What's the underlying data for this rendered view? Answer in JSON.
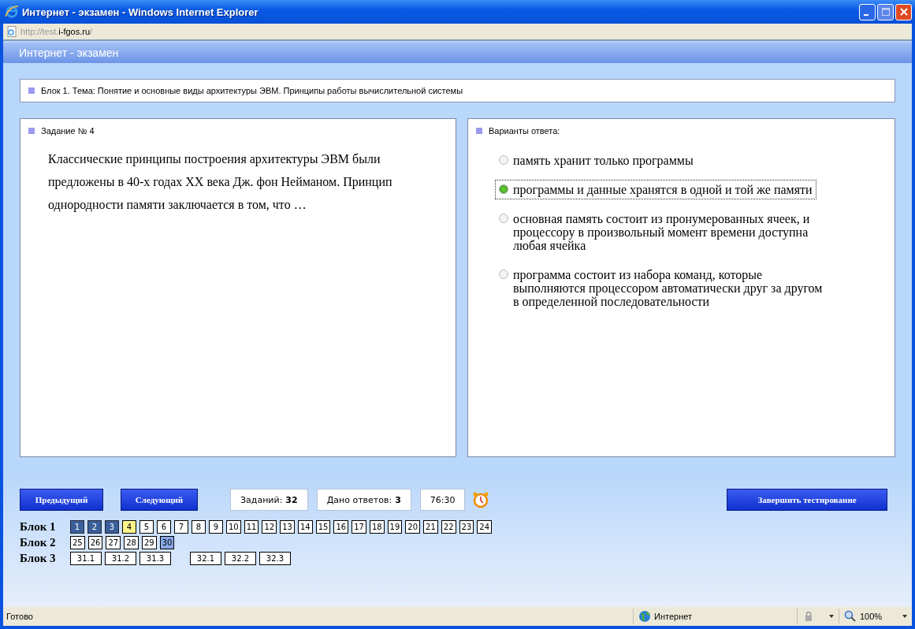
{
  "window": {
    "title": "Интернет - экзамен - Windows Internet Explorer"
  },
  "address": [
    {
      "text": "http://test.",
      "kind": "muted"
    },
    {
      "text": "i-fgos.ru",
      "kind": "host"
    },
    {
      "text": "/",
      "kind": "muted"
    }
  ],
  "page_header": "Интернет - экзамен",
  "topic": "Блок 1. Тема: Понятие и основные виды архитектуры ЭВМ. Принципы работы вычислительной системы",
  "task": {
    "title": "Задание № 4",
    "text": "Классические принципы построения архитектуры ЭВМ были предложены в 40-х годах XX века Дж. фон Нейманом. Принцип однородности памяти заключается в том, что …"
  },
  "answers": {
    "title": "Варианты ответа:",
    "options": [
      {
        "text": "память хранит только программы",
        "selected": false
      },
      {
        "text": "программы и данные хранятся в одной и той же памяти",
        "selected": true
      },
      {
        "text": "основная память состоит из пронумерованных ячеек, и процессору в произвольный момент времени доступна любая ячейка",
        "selected": false
      },
      {
        "text": "программа состоит из набора команд, которые выполняются процессором автоматически друг за другом в определенной последовательности",
        "selected": false
      }
    ]
  },
  "buttons": {
    "prev": "Предыдущий",
    "next": "Следующий",
    "finish": "Завершить тестирование"
  },
  "stats": [
    {
      "label": "Заданий:",
      "value": "32"
    },
    {
      "label": "Дано ответов:",
      "value": "3"
    },
    {
      "value": "76:30"
    }
  ],
  "blocks": [
    {
      "label": "Блок 1",
      "groups": [
        [
          {
            "n": "1",
            "kind": "answered"
          },
          {
            "n": "2",
            "kind": "answered"
          },
          {
            "n": "3",
            "kind": "answered"
          },
          {
            "n": "4",
            "kind": "current"
          },
          {
            "n": "5",
            "kind": "plain"
          },
          {
            "n": "6",
            "kind": "plain"
          },
          {
            "n": "7",
            "kind": "plain"
          },
          {
            "n": "8",
            "kind": "plain"
          },
          {
            "n": "9",
            "kind": "plain"
          },
          {
            "n": "10",
            "kind": "plain"
          },
          {
            "n": "11",
            "kind": "plain"
          },
          {
            "n": "12",
            "kind": "plain"
          },
          {
            "n": "13",
            "kind": "plain"
          },
          {
            "n": "14",
            "kind": "plain"
          },
          {
            "n": "15",
            "kind": "plain"
          },
          {
            "n": "16",
            "kind": "plain"
          },
          {
            "n": "17",
            "kind": "plain"
          },
          {
            "n": "18",
            "kind": "plain"
          },
          {
            "n": "19",
            "kind": "plain"
          },
          {
            "n": "20",
            "kind": "plain"
          },
          {
            "n": "21",
            "kind": "plain"
          },
          {
            "n": "22",
            "kind": "plain"
          },
          {
            "n": "23",
            "kind": "plain"
          },
          {
            "n": "24",
            "kind": "plain"
          }
        ]
      ]
    },
    {
      "label": "Блок 2",
      "groups": [
        [
          {
            "n": "25",
            "kind": "plain"
          },
          {
            "n": "26",
            "kind": "plain"
          },
          {
            "n": "27",
            "kind": "plain"
          },
          {
            "n": "28",
            "kind": "plain"
          },
          {
            "n": "29",
            "kind": "plain"
          },
          {
            "n": "30",
            "kind": "flagged"
          }
        ]
      ]
    },
    {
      "label": "Блок 3",
      "groups": [
        [
          {
            "n": "31.1",
            "kind": "plain"
          },
          {
            "n": "31.2",
            "kind": "plain"
          },
          {
            "n": "31.3",
            "kind": "plain"
          }
        ],
        [
          {
            "n": "32.1",
            "kind": "plain"
          },
          {
            "n": "32.2",
            "kind": "plain"
          },
          {
            "n": "32.3",
            "kind": "plain"
          }
        ]
      ]
    }
  ],
  "status_bar": {
    "text": "Готово",
    "zone": "Интернет",
    "zoom": "100%"
  }
}
